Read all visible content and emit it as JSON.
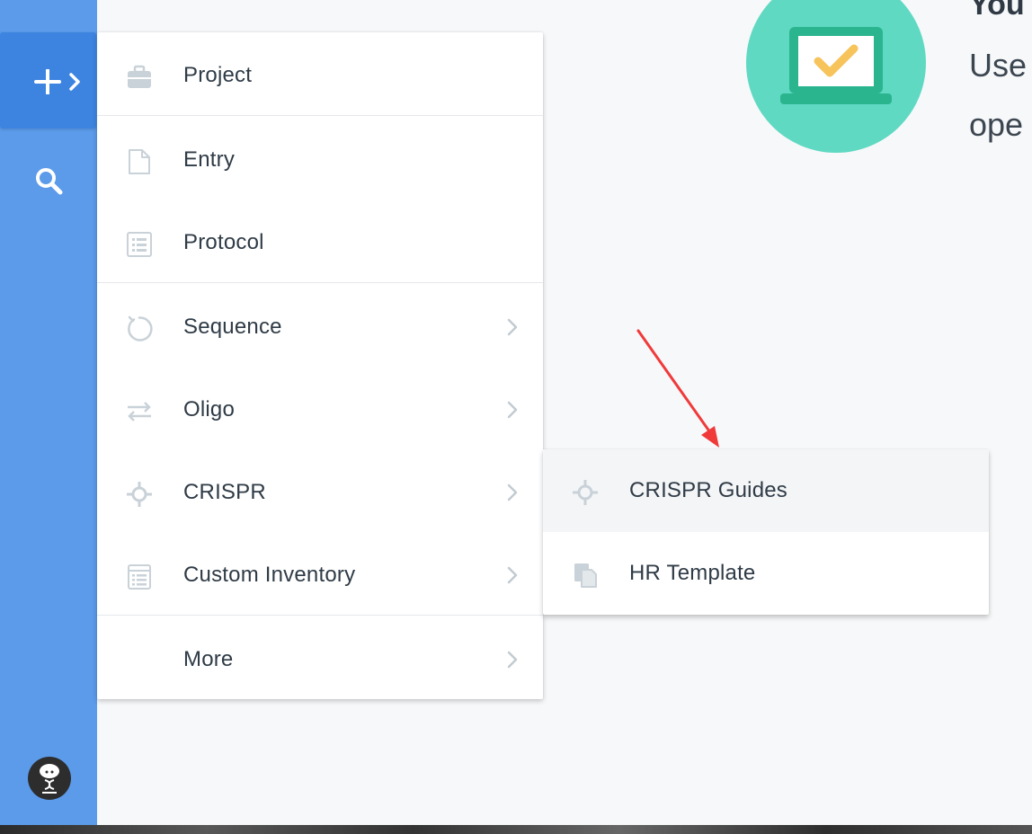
{
  "sidebar": {
    "create_icon": "plus-chevron-icon",
    "search_icon": "search-icon",
    "avatar_icon": "user-avatar-icon",
    "color": "#5b9bea",
    "active_color": "#3d84e0"
  },
  "background": {
    "title": "You",
    "line1": "Use",
    "line2": "ope",
    "illustration_icon": "laptop-checkmark-icon",
    "illustration_color": "#5fd9c2"
  },
  "menu": {
    "items": [
      {
        "label": "Project",
        "icon": "briefcase-icon",
        "has_submenu": false
      },
      {
        "label": "Entry",
        "icon": "document-icon",
        "has_submenu": false
      },
      {
        "label": "Protocol",
        "icon": "list-icon",
        "has_submenu": false
      },
      {
        "label": "Sequence",
        "icon": "circle-sequence-icon",
        "has_submenu": true
      },
      {
        "label": "Oligo",
        "icon": "arrows-exchange-icon",
        "has_submenu": true
      },
      {
        "label": "CRISPR",
        "icon": "crosshair-icon",
        "has_submenu": true
      },
      {
        "label": "Custom Inventory",
        "icon": "inventory-list-icon",
        "has_submenu": true
      },
      {
        "label": "More",
        "icon": "",
        "has_submenu": true
      }
    ]
  },
  "submenu": {
    "parent": "CRISPR",
    "items": [
      {
        "label": "CRISPR Guides",
        "icon": "crosshair-icon",
        "highlighted": true
      },
      {
        "label": "HR Template",
        "icon": "copy-document-icon",
        "highlighted": false
      }
    ]
  },
  "annotation": {
    "icon": "red-arrow-icon",
    "color": "#f03a3a"
  }
}
